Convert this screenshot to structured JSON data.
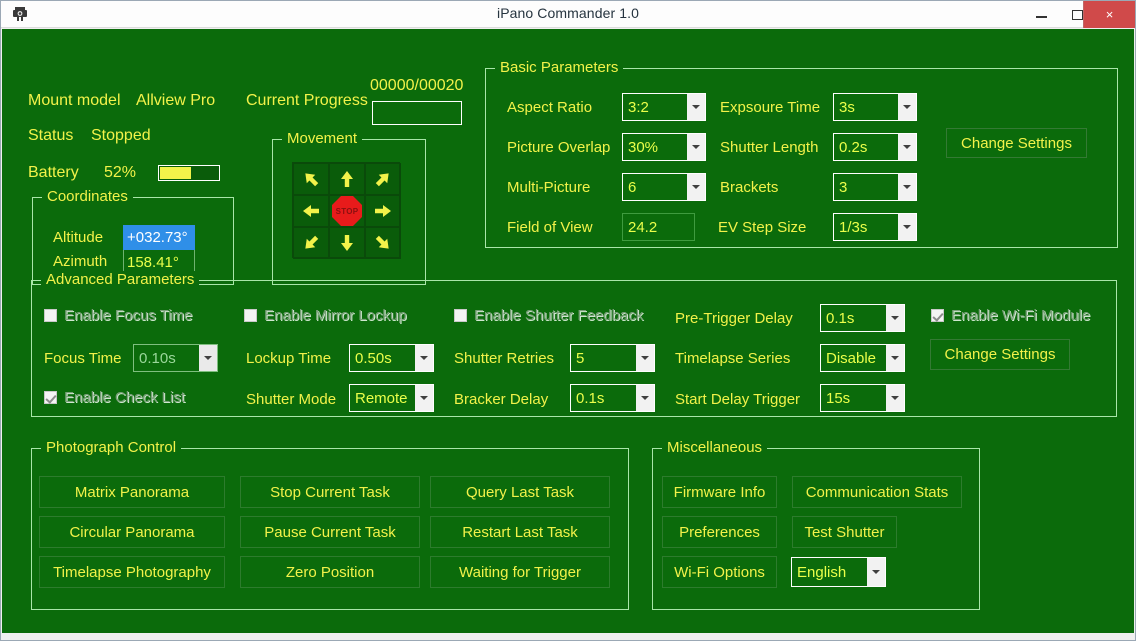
{
  "window": {
    "title": "iPano Commander 1.0",
    "icon": "camera-mount-icon",
    "minimize_label": "–",
    "maximize_label": "",
    "close_label": "×",
    "accent_close": "#d04a4a",
    "client_bg": "#0b6b0b",
    "text_color": "#f2f24a"
  },
  "status": {
    "mount_model_label": "Mount model",
    "mount_model_value": "Allview Pro",
    "status_label": "Status",
    "status_value": "Stopped",
    "battery_label": "Battery",
    "battery_value": "52%",
    "battery_percent": 52,
    "progress_label": "Current Progress",
    "progress_count": "00000/00020",
    "progress_percent": 0
  },
  "coordinates": {
    "legend": "Coordinates",
    "altitude_label": "Altitude",
    "altitude_value": "+032.73°",
    "azimuth_label": "Azimuth",
    "azimuth_value": "158.41°",
    "selection_color": "#2f8fe8"
  },
  "movement": {
    "legend": "Movement",
    "stop_label": "STOP",
    "buttons": [
      {
        "name": "move-up-left-icon",
        "dir": "up-left"
      },
      {
        "name": "move-up-icon",
        "dir": "up"
      },
      {
        "name": "move-up-right-icon",
        "dir": "up-right"
      },
      {
        "name": "move-left-icon",
        "dir": "left"
      },
      {
        "name": "stop-octagon-icon",
        "dir": "stop"
      },
      {
        "name": "move-right-icon",
        "dir": "right"
      },
      {
        "name": "move-down-left-icon",
        "dir": "down-left"
      },
      {
        "name": "move-down-icon",
        "dir": "down"
      },
      {
        "name": "move-down-right-icon",
        "dir": "down-right"
      }
    ]
  },
  "basic_parameters": {
    "legend": "Basic Parameters",
    "aspect_ratio_label": "Aspect Ratio",
    "aspect_ratio_value": "3:2",
    "exposure_time_label": "Expsoure Time",
    "exposure_time_value": "3s",
    "picture_overlap_label": "Picture Overlap",
    "picture_overlap_value": "30%",
    "shutter_length_label": "Shutter Length",
    "shutter_length_value": "0.2s",
    "multi_picture_label": "Multi-Picture",
    "multi_picture_value": "6",
    "brackets_label": "Brackets",
    "brackets_value": "3",
    "field_of_view_label": "Field of View",
    "field_of_view_value": "24.2",
    "ev_step_size_label": "EV Step Size",
    "ev_step_size_value": "1/3s",
    "change_settings_label": "Change Settings"
  },
  "advanced_parameters": {
    "legend": "Advanced Parameters",
    "enable_focus_time_label": "Enable Focus Time",
    "enable_focus_time_checked": false,
    "enable_mirror_lockup_label": "Enable Mirror Lockup",
    "enable_mirror_lockup_checked": false,
    "enable_shutter_feedback_label": "Enable Shutter Feedback",
    "enable_shutter_feedback_checked": false,
    "enable_wifi_module_label": "Enable Wi-Fi Module",
    "enable_wifi_module_checked": true,
    "enable_check_list_label": "Enable Check List",
    "enable_check_list_checked": true,
    "focus_time_label": "Focus Time",
    "focus_time_value": "0.10s",
    "lockup_time_label": "Lockup Time",
    "lockup_time_value": "0.50s",
    "shutter_retries_label": "Shutter Retries",
    "shutter_retries_value": "5",
    "pre_trigger_delay_label": "Pre-Trigger Delay",
    "pre_trigger_delay_value": "0.1s",
    "timelapse_series_label": "Timelapse Series",
    "timelapse_series_value": "Disable",
    "shutter_mode_label": "Shutter Mode",
    "shutter_mode_value": "Remote",
    "bracker_delay_label": "Bracker Delay",
    "bracker_delay_value": "0.1s",
    "start_delay_trigger_label": "Start Delay Trigger",
    "start_delay_trigger_value": "15s",
    "change_settings_label": "Change Settings"
  },
  "photograph_control": {
    "legend": "Photograph Control",
    "buttons": [
      "Matrix Panorama",
      "Stop Current Task",
      "Query Last Task",
      "Circular Panorama",
      "Pause Current Task",
      "Restart Last Task",
      "Timelapse Photography",
      "Zero Position",
      "Waiting for Trigger"
    ]
  },
  "miscellaneous": {
    "legend": "Miscellaneous",
    "firmware_info_label": "Firmware Info",
    "communication_stats_label": "Communication Stats",
    "preferences_label": "Preferences",
    "test_shutter_label": "Test Shutter",
    "wifi_options_label": "Wi-Fi Options",
    "language_value": "English"
  }
}
